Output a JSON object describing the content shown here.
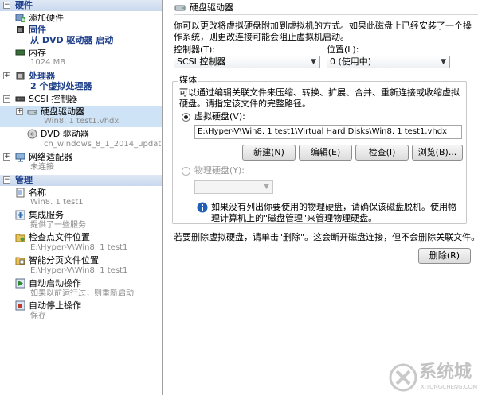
{
  "tree": {
    "hardware": {
      "label": "硬件",
      "add_hardware": "添加硬件",
      "firmware": "固件",
      "firmware_sub": "从 DVD 驱动器 启动",
      "memory": "内存",
      "memory_sub": "1024 MB",
      "processor": "处理器",
      "processor_sub": "2 个虚拟处理器",
      "scsi": "SCSI 控制器",
      "hdd": "硬盘驱动器",
      "hdd_sub": "Win8. 1 test1.vhdx",
      "dvd": "DVD 驱动器",
      "dvd_sub": "cn_windows_8_1_2014_updat...",
      "nic": "网络适配器",
      "nic_sub": "未连接"
    },
    "management": {
      "label": "管理",
      "name": "名称",
      "name_sub": "Win8. 1 test1",
      "integration": "集成服务",
      "integration_sub": "提供了一些服务",
      "checkpoint": "检查点文件位置",
      "checkpoint_sub": "E:\\Hyper-V\\Win8. 1 test1",
      "paging": "智能分页文件位置",
      "paging_sub": "E:\\Hyper-V\\Win8. 1 test1",
      "autostart": "自动启动操作",
      "autostart_sub": "如果以前运行过，则重新启动",
      "autostop": "自动停止操作",
      "autostop_sub": "保存"
    }
  },
  "panel": {
    "title": "硬盘驱动器",
    "description": "你可以更改将虚拟硬盘附加到虚拟机的方式。如果此磁盘上已经安装了一个操作系统，则更改连接可能会阻止虚拟机启动。",
    "controller_label": "控制器(T):",
    "controller_value": "SCSI 控制器",
    "location_label": "位置(L):",
    "location_value": "0 (使用中)",
    "media_label": "媒体",
    "media_desc": "可以通过编辑关联文件来压缩、转换、扩展、合并、重新连接或收缩虚拟硬盘。请指定该文件的完整路径。",
    "vhd_label": "虚拟硬盘(V):",
    "vhd_path": "E:\\Hyper-V\\Win8. 1 test1\\Virtual Hard Disks\\Win8. 1 test1.vhdx",
    "btn_new": "新建(N)",
    "btn_edit": "编辑(E)",
    "btn_inspect": "检查(I)",
    "btn_browse": "浏览(B)...",
    "phys_label": "物理硬盘(Y):",
    "phys_info": "如果没有列出你要使用的物理硬盘，请确保该磁盘脱机。使用物理计算机上的\"磁盘管理\"来管理物理硬盘。",
    "remove_note": "若要删除虚拟硬盘，请单击\"删除\"。这会断开磁盘连接，但不会删除关联文件。",
    "btn_remove": "删除(R)"
  },
  "watermark": {
    "text": "系统城",
    "sub": "XITONGCHENG.COM"
  },
  "colors": {
    "category_text": "#1e3f8a",
    "selected_row": "#cfe3f7"
  }
}
